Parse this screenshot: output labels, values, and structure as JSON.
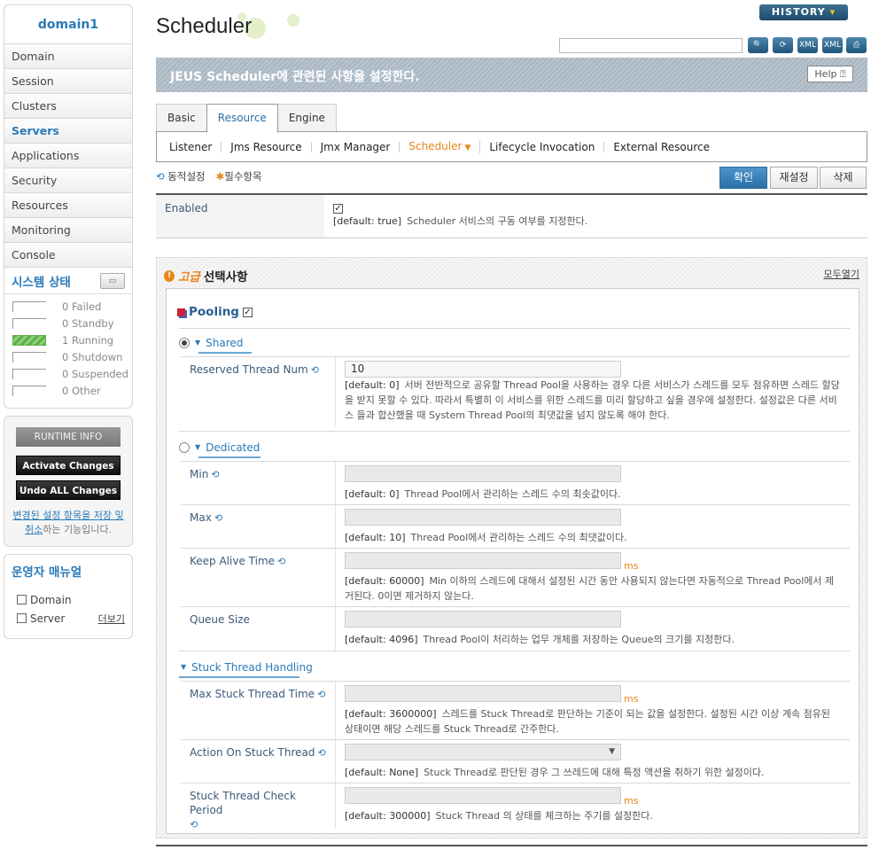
{
  "sidebar": {
    "domain": "domain1",
    "menu": [
      "Domain",
      "Session",
      "Clusters",
      "Servers",
      "Applications",
      "Security",
      "Resources",
      "Monitoring",
      "Console"
    ],
    "active_menu": "Servers",
    "status_title": "시스템 상태",
    "status": [
      {
        "count": "0",
        "label": "Failed"
      },
      {
        "count": "0",
        "label": "Standby"
      },
      {
        "count": "1",
        "label": "Running"
      },
      {
        "count": "0",
        "label": "Shutdown"
      },
      {
        "count": "0",
        "label": "Suspended"
      },
      {
        "count": "0",
        "label": "Other"
      }
    ],
    "runtime_info": "RUNTIME INFO",
    "activate_changes": "Activate Changes",
    "undo_changes": "Undo ALL Changes",
    "changes_note_link": "변경된 설정 항목을 저장 및 취소",
    "changes_note_rest": "하는 기능입니다.",
    "manual_title": "운영자 매뉴얼",
    "manual_items": [
      "Domain",
      "Server"
    ],
    "more": "더보기"
  },
  "header": {
    "title": "Scheduler",
    "history": "HISTORY",
    "search_placeholder": "",
    "tool_icons": [
      "search-icon",
      "refresh-icon",
      "xml-download-icon",
      "xml-export-icon",
      "print-icon"
    ],
    "tool_glyphs": [
      "🔍",
      "⟳",
      "XML",
      "XML",
      "⎙"
    ],
    "description": "JEUS Scheduler에 관련된 사항을 설정한다.",
    "help": "Help"
  },
  "tabs": [
    "Basic",
    "Resource",
    "Engine"
  ],
  "active_tab": "Resource",
  "subtabs": [
    "Listener",
    "Jms Resource",
    "Jmx Manager",
    "Scheduler",
    "Lifecycle Invocation",
    "External Resource"
  ],
  "active_subtab": "Scheduler",
  "legend": {
    "dynamic": "동적설정",
    "required": "필수항목"
  },
  "buttons": {
    "confirm": "확인",
    "reset": "재설정",
    "delete": "삭제"
  },
  "enabled": {
    "label": "Enabled",
    "checked": true,
    "default": "[default: true]",
    "desc": "Scheduler 서비스의 구동 여부를 지정한다."
  },
  "advanced": {
    "prefix": "고급",
    "title": "선택사항",
    "expand_all": "모두열기",
    "pooling": "Pooling",
    "shared_label": "Shared",
    "dedicated_label": "Dedicated",
    "stuck_label": "Stuck Thread Handling",
    "reserved": {
      "label": "Reserved Thread Num",
      "value": "10",
      "default": "[default: 0]",
      "desc": "서버 전반적으로 공유할 Thread Pool을 사용하는 경우 다른 서비스가 스레드를 모두 점유하면 스레드 할당을 받지 못할 수 있다. 따라서 특별히 이 서비스를 위한 스레드를 미리 할당하고 싶을 경우에 설정한다. 설정값은 다른 서비스 들과 합산했을 때 System Thread Pool의 최댓값을 넘지 않도록 해야 한다."
    },
    "min": {
      "label": "Min",
      "default": "[default: 0]",
      "desc": "Thread Pool에서 관리하는 스레드 수의 최솟값이다."
    },
    "max": {
      "label": "Max",
      "default": "[default: 10]",
      "desc": "Thread Pool에서 관리하는 스레드 수의 최댓값이다."
    },
    "keepalive": {
      "label": "Keep Alive Time",
      "unit": "ms",
      "default": "[default: 60000]",
      "desc": "Min 이하의 스레드에 대해서 설정된 시간 동안 사용되지 않는다면 자동적으로 Thread Pool에서 제거된다. 0이면 제거하지 않는다."
    },
    "queue": {
      "label": "Queue Size",
      "default": "[default: 4096]",
      "desc": "Thread Pool이 처리하는 업무 개체를 저장하는 Queue의 크기를 지정한다."
    },
    "maxstuck": {
      "label": "Max Stuck Thread Time",
      "unit": "ms",
      "default": "[default: 3600000]",
      "desc": "스레드를 Stuck Thread로 판단하는 기준이 되는 값을 설정한다. 설정된 시간 이상 계속 점유된 상태이면 해당 스레드를 Stuck Thread로 간주한다."
    },
    "action": {
      "label": "Action On Stuck Thread",
      "default": "[default: None]",
      "desc": "Stuck Thread로 판단된 경우 그 쓰레드에 대해 특정 액션을 취하기 위한 설정이다."
    },
    "checkperiod": {
      "label": "Stuck Thread Check Period",
      "unit": "ms",
      "default": "[default: 300000]",
      "desc": "Stuck Thread 의 상태를 체크하는 주기를 설정한다."
    }
  }
}
